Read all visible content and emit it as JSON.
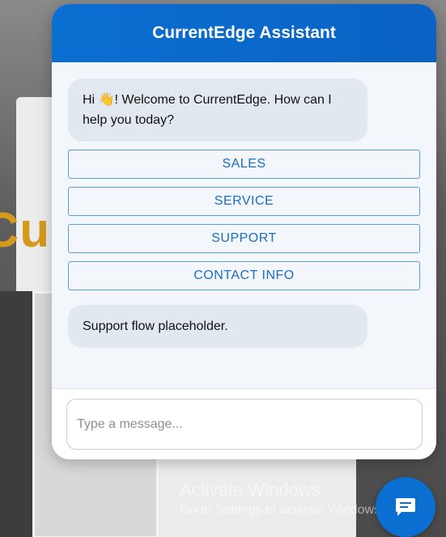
{
  "background": {
    "brand_partial": "Cur"
  },
  "chat": {
    "title": "CurrentEdge Assistant",
    "welcome": {
      "greeting": "Hi",
      "wave_icon": "👋",
      "rest": "! Welcome to CurrentEdge. How can I help you today?"
    },
    "options": [
      {
        "label": "SALES"
      },
      {
        "label": "SERVICE"
      },
      {
        "label": "SUPPORT"
      },
      {
        "label": "CONTACT INFO"
      }
    ],
    "reply": "Support flow placeholder.",
    "input": {
      "placeholder": "Type a message...",
      "value": ""
    }
  },
  "watermark": {
    "title": "Activate Windows",
    "subtitle": "Go to Settings to activate Windows."
  },
  "launcher": {
    "icon": "chat-bubble-icon"
  },
  "colors": {
    "accent": "#0a6fd1",
    "option_border": "#5a9de0",
    "option_text": "#1a6ec4",
    "bubble_bg": "#e2e8f0",
    "brand": "#d59a1c"
  }
}
